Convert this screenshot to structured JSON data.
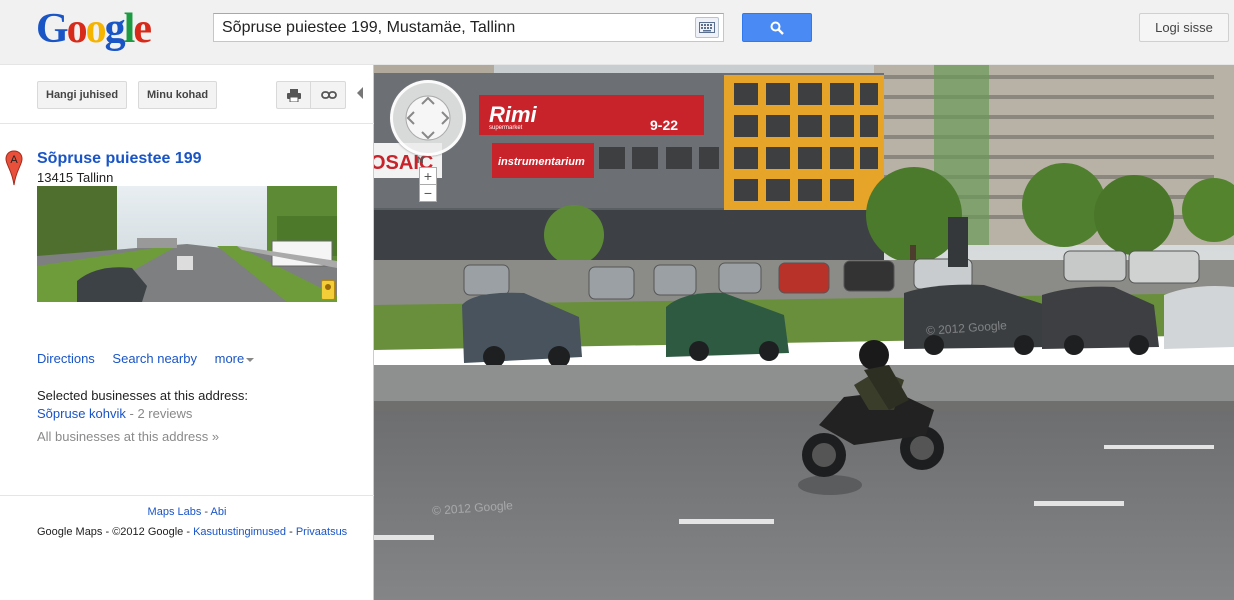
{
  "header": {
    "logo_text": "Google",
    "search_value": "Sõpruse puiestee 199, Mustamäe, Tallinn",
    "keyboard_icon": "keyboard-icon",
    "search_icon": "magnifier-icon",
    "signin_label": "Logi sisse"
  },
  "toolbar": {
    "directions_label": "Hangi juhised",
    "myplaces_label": "Minu kohad",
    "print_icon": "printer-icon",
    "link_icon": "link-icon"
  },
  "place": {
    "marker_label": "A",
    "title": "Sõpruse puiestee 199",
    "postal": "13415 Tallinn",
    "actions": {
      "directions": "Directions",
      "search_nearby": "Search nearby",
      "more": "more"
    },
    "businesses_heading": "Selected businesses at this address:",
    "business": {
      "name": "Sõpruse kohvik",
      "reviews": " - 2 reviews"
    },
    "all_businesses": "All businesses at this address »"
  },
  "footer": {
    "maps_labs": "Maps Labs",
    "sep1": " - ",
    "help": "Abi",
    "legal_prefix": "Google Maps - ©2012 Google - ",
    "terms": "Kasutustingimused",
    "sep2": " - ",
    "privacy": "Privaatsus"
  },
  "streetview": {
    "zoom_in": "+",
    "zoom_out": "−",
    "compass_label": "N",
    "copyright": "© 2012 Google",
    "store_sign": "Rimi",
    "store_subsign": "supermarket",
    "hours": "9-22",
    "sign2": "instrumentarium",
    "sign3": "OSAIC"
  },
  "colors": {
    "link": "#1a55c6",
    "search_button": "#4a8af4"
  }
}
